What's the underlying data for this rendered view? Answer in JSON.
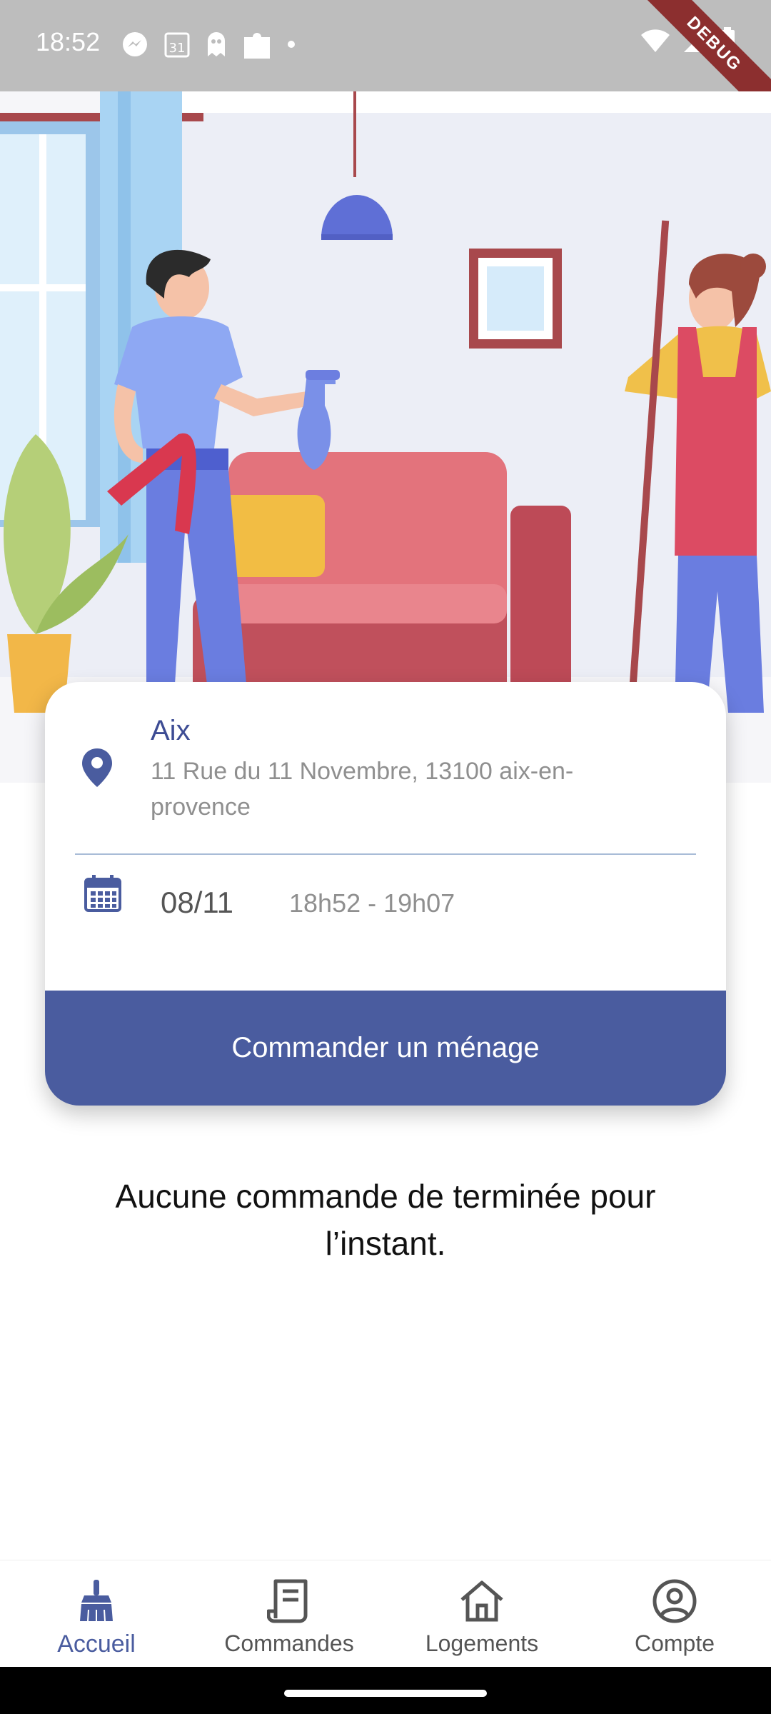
{
  "status_bar": {
    "time": "18:52",
    "left_icons": [
      "messenger-icon",
      "calendar-31-icon",
      "ghost-icon",
      "puzzle-icon",
      "dot-icon"
    ],
    "right_icons": [
      "wifi-icon",
      "signal-icon",
      "battery-icon"
    ],
    "debug_label": "DEBUG"
  },
  "location": {
    "name": "Aix",
    "address": "11 Rue du 11 Novembre, 13100 aix-en-provence"
  },
  "schedule": {
    "date": "08/11",
    "time_range": "18h52 - 19h07"
  },
  "order_button_label": "Commander un ménage",
  "empty_message": "Aucune commande de terminée pour l’instant.",
  "bottom_nav": [
    {
      "label": "Accueil",
      "icon": "broom-icon",
      "active": true
    },
    {
      "label": "Commandes",
      "icon": "receipt-icon",
      "active": false
    },
    {
      "label": "Logements",
      "icon": "home-icon",
      "active": false
    },
    {
      "label": "Compte",
      "icon": "account-circle-icon",
      "active": false
    }
  ],
  "colors": {
    "accent": "#4a5c9f",
    "status_bar": "#bdbdbd",
    "debug_ribbon": "#8c2f2f"
  }
}
